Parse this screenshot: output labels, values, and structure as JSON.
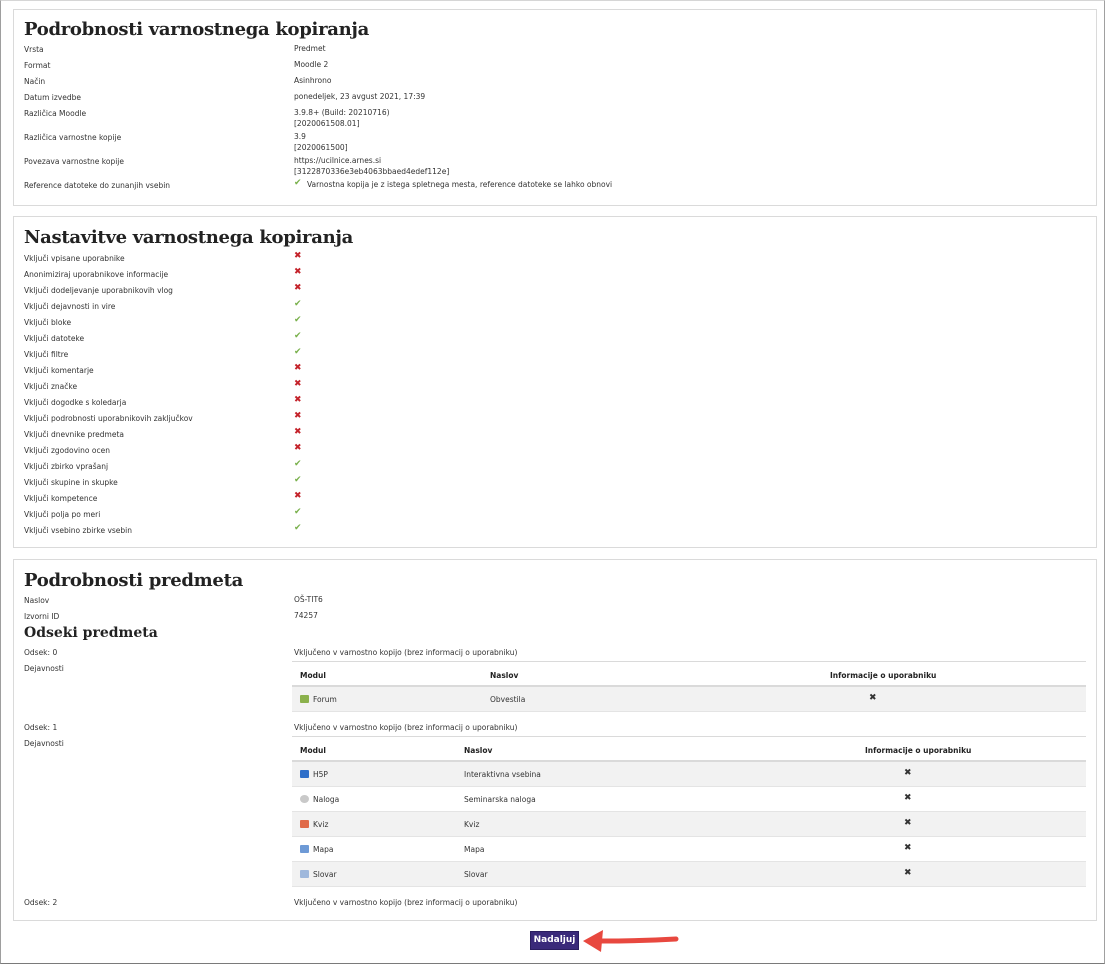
{
  "details": {
    "title": "Podrobnosti varnostnega kopiranja",
    "rows": [
      {
        "label": "Vrsta",
        "value": "Predmet"
      },
      {
        "label": "Format",
        "value": "Moodle 2"
      },
      {
        "label": "Način",
        "value": "Asinhrono"
      },
      {
        "label": "Datum izvedbe",
        "value": "ponedeljek, 23 avgust 2021, 17:39"
      },
      {
        "label": "Različica Moodle",
        "value": "3.9.8+ (Build: 20210716)",
        "value2": "[2020061508.01]"
      },
      {
        "label": "Različica varnostne kopije",
        "value": "3.9",
        "value2": "[2020061500]"
      },
      {
        "label": "Povezava varnostne kopije",
        "value": "https://ucilnice.arnes.si",
        "value2": "[3122870336e3eb4063bbaed4edef112e]"
      },
      {
        "label": "Reference datoteke do zunanjih vsebin",
        "value": "Varnostna kopija je z istega spletnega mesta, reference datoteke se lahko obnovi",
        "icon": "check-icon"
      }
    ]
  },
  "settings": {
    "title": "Nastavitve varnostnega kopiranja",
    "rows": [
      {
        "label": "Vključi vpisane uporabnike",
        "icon": "cross-icon"
      },
      {
        "label": "Anonimiziraj uporabnikove informacije",
        "icon": "cross-icon"
      },
      {
        "label": "Vključi dodeljevanje uporabnikovih vlog",
        "icon": "cross-icon"
      },
      {
        "label": "Vključi dejavnosti in vire",
        "icon": "check-icon"
      },
      {
        "label": "Vključi bloke",
        "icon": "check-icon"
      },
      {
        "label": "Vključi datoteke",
        "icon": "check-icon"
      },
      {
        "label": "Vključi filtre",
        "icon": "check-icon"
      },
      {
        "label": "Vključi komentarje",
        "icon": "cross-icon"
      },
      {
        "label": "Vključi značke",
        "icon": "cross-icon"
      },
      {
        "label": "Vključi dogodke s koledarja",
        "icon": "cross-icon"
      },
      {
        "label": "Vključi podrobnosti uporabnikovih zaključkov",
        "icon": "cross-icon"
      },
      {
        "label": "Vključi dnevnike predmeta",
        "icon": "cross-icon"
      },
      {
        "label": "Vključi zgodovino ocen",
        "icon": "cross-icon"
      },
      {
        "label": "Vključi zbirko vprašanj",
        "icon": "check-icon"
      },
      {
        "label": "Vključi skupine in skupke",
        "icon": "check-icon"
      },
      {
        "label": "Vključi kompetence",
        "icon": "cross-icon"
      },
      {
        "label": "Vključi polja po meri",
        "icon": "check-icon"
      },
      {
        "label": "Vključi vsebino zbirke vsebin",
        "icon": "check-icon"
      }
    ]
  },
  "course": {
    "title": "Podrobnosti predmeta",
    "rows": [
      {
        "label": "Naslov",
        "value": "OŠ-TIT6"
      },
      {
        "label": "Izvorni ID",
        "value": "74257"
      }
    ],
    "sections_title": "Odseki predmeta",
    "activities_label": "Dejavnosti",
    "included_text": "Vključeno v varnostno kopijo (brez informacij o uporabniku)",
    "table_headers": {
      "module": "Modul",
      "title": "Naslov",
      "userinfo": "Informacije o uporabniku"
    },
    "sections": [
      {
        "label": "Odsek: 0",
        "activities": [
          {
            "module": "Forum",
            "title": "Obvestila",
            "icon": "forum-icon"
          }
        ]
      },
      {
        "label": "Odsek: 1",
        "activities": [
          {
            "module": "H5P",
            "title": "Interaktivna vsebina",
            "icon": "h5p-icon"
          },
          {
            "module": "Naloga",
            "title": "Seminarska naloga",
            "icon": "assignment-icon"
          },
          {
            "module": "Kviz",
            "title": "Kviz",
            "icon": "quiz-icon"
          },
          {
            "module": "Mapa",
            "title": "Mapa",
            "icon": "folder-icon"
          },
          {
            "module": "Slovar",
            "title": "Slovar",
            "icon": "glossary-icon"
          }
        ]
      },
      {
        "label": "Odsek: 2",
        "activities": []
      }
    ]
  },
  "continue_button": "Nadaljuj",
  "colors": {
    "button": "#3a2a7a",
    "cross": "#c4222a",
    "check": "#78b04a",
    "arrow": "#e8483f"
  }
}
